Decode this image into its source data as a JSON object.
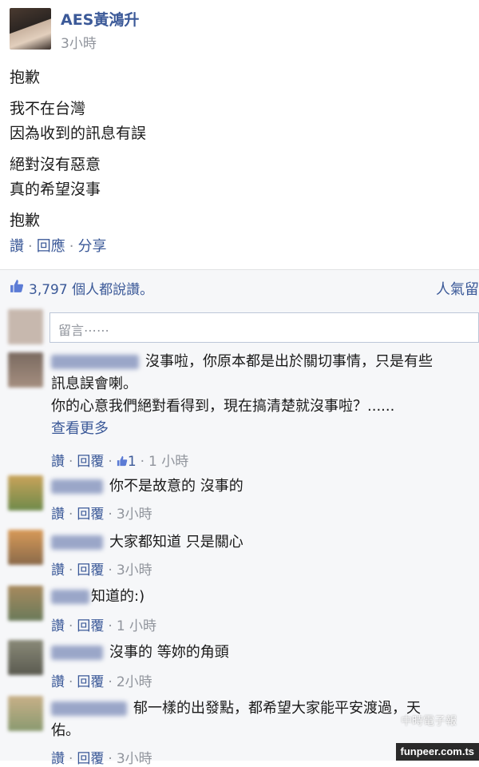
{
  "post": {
    "author": "AES黃鴻升",
    "time": "3小時",
    "lines": [
      "抱歉",
      "我不在台灣",
      "因為收到的訊息有誤",
      "絕對沒有惡意",
      "真的希望沒事",
      "抱歉"
    ],
    "actions": {
      "like": "讚",
      "reply": "回應",
      "share": "分享"
    }
  },
  "likes": {
    "text": "3,797 個人都說讚。",
    "popular": "人氣留"
  },
  "comment_input": {
    "placeholder": "留言⋯⋯"
  },
  "comments": [
    {
      "text1": "沒事啦，你原本都是出於關切事情，只是有些",
      "text2": "訊息誤會喇。",
      "text3": "你的心意我們絕對看得到，現在搞清楚就沒事啦？......",
      "see_more": "查看更多",
      "like": "讚",
      "reply": "回覆",
      "like_count": "1",
      "time": "1 小時"
    },
    {
      "text": "你不是故意的 沒事的",
      "like": "讚",
      "reply": "回覆",
      "time": "3小時"
    },
    {
      "text": "大家都知道 只是關心",
      "like": "讚",
      "reply": "回覆",
      "time": "3小時"
    },
    {
      "text": "知道的:)",
      "like": "讚",
      "reply": "回覆",
      "time": "1 小時"
    },
    {
      "text": "沒事的 等妳的角頭",
      "like": "讚",
      "reply": "回覆",
      "time": "2小時"
    },
    {
      "text1": "郁一樣的出發點，都希望大家能平安渡過，天",
      "text2": "佑。",
      "like": "讚",
      "reply": "回覆",
      "time": "3小時"
    }
  ],
  "watermarks": {
    "chinatimes": "中時電子報",
    "funpeer": "funpeer.com.ts"
  },
  "colors": {
    "link": "#3b5998",
    "muted": "#90949c",
    "bar": "#f6f7f9"
  }
}
